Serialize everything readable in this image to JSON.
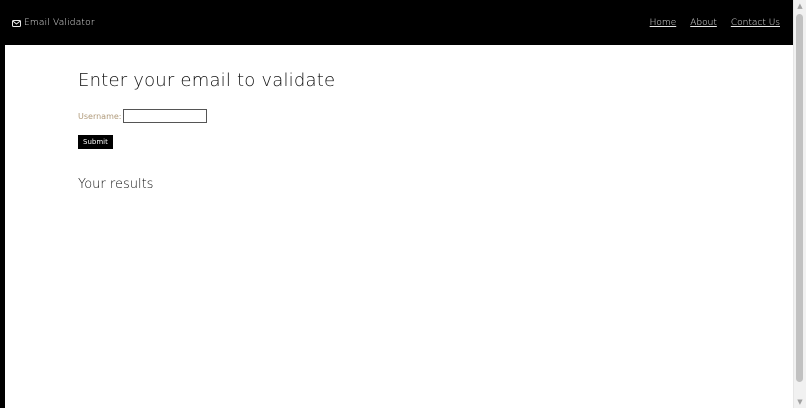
{
  "navbar": {
    "brand_label": "Email Validator",
    "brand_icon": "envelope-icon",
    "links": [
      {
        "label": "Home"
      },
      {
        "label": "About"
      },
      {
        "label": "Contact Us"
      }
    ]
  },
  "main": {
    "title": "Enter your email to validate",
    "form": {
      "username_label": "Username:",
      "username_value": "",
      "submit_label": "Submit"
    },
    "results_title": "Your results"
  },
  "colors": {
    "navbar_bg": "#000000",
    "label_color": "#b09a7a"
  }
}
